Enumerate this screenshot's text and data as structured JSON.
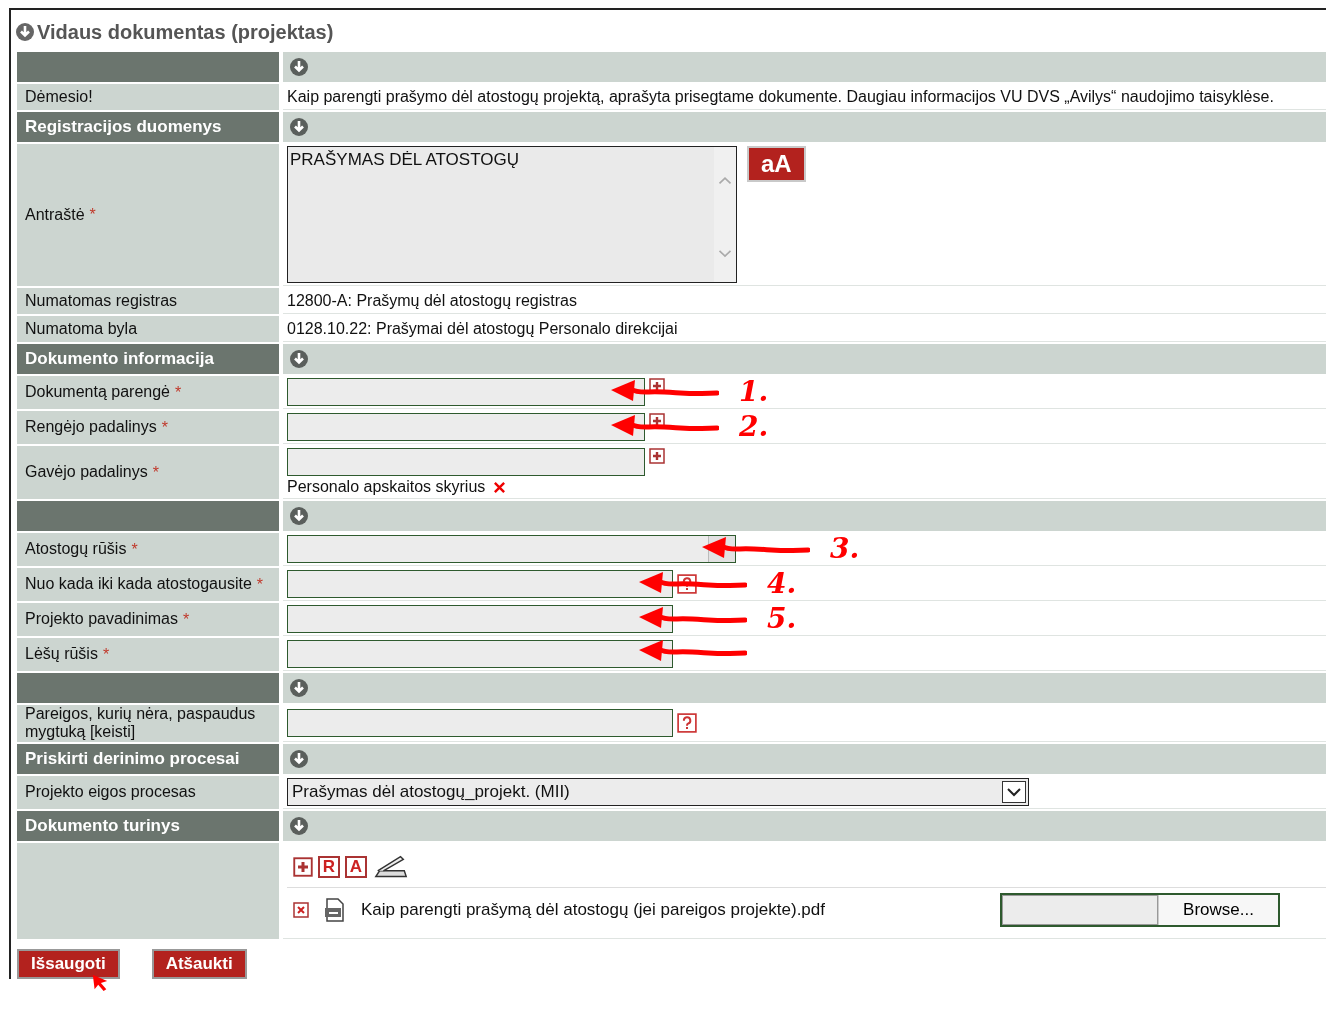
{
  "title": "Vidaus dokumentas (projektas)",
  "sections": [
    {
      "rows": [
        {
          "kind": "text",
          "label": "Dėmesio!",
          "value": "Kaip parengti prašymo dėl atostogų projektą, aprašyta prisegtame dokumente. Daugiau informacijos VU DVS „Avilys“ naudojimo taisyklėse."
        }
      ]
    },
    {
      "heading": "Registracijos duomenys",
      "rows": [
        {
          "kind": "textarea",
          "label": "Antraštė",
          "mark": "*",
          "value": "PRAŠYMAS DĖL ATOSTOGŲ",
          "case_button": "aA"
        },
        {
          "kind": "text",
          "label": "Numatomas registras",
          "value": "12800-A: Prašymų dėl atostogų registras"
        },
        {
          "kind": "text",
          "label": "Numatoma byla",
          "value": "0128.10.22: Prašymai dėl atostogų Personalo direkcijai"
        }
      ]
    },
    {
      "heading": "Dokumento informacija",
      "rows": [
        {
          "kind": "input",
          "label": "Dokumentą parengė",
          "mark": "*",
          "add_button": true,
          "arrow": true,
          "note": "1."
        },
        {
          "kind": "input",
          "label": "Rengėjo padalinys",
          "mark": "*",
          "add_button": true,
          "arrow": true,
          "note": "2."
        },
        {
          "kind": "input",
          "label": "Gavėjo padalinys",
          "mark": "*",
          "add_button": true,
          "items": [
            "Personalo apskaitos skyrius"
          ]
        }
      ]
    },
    {
      "rows": [
        {
          "kind": "combo",
          "label": "Atostogų rūšis",
          "mark": "*",
          "arrow": true,
          "note": "3."
        },
        {
          "kind": "wide",
          "label": "Nuo kada iki kada atostogausite",
          "mark": "*",
          "help_button": true,
          "arrow": true,
          "note": "4."
        },
        {
          "kind": "wide",
          "label": "Projekto pavadinimas",
          "mark": "*",
          "arrow": true,
          "note": "5."
        },
        {
          "kind": "wide",
          "label": "Lėšų rūšis",
          "mark": "*",
          "arrow": true
        }
      ]
    },
    {
      "rows": [
        {
          "kind": "wide",
          "label": "Pareigos, kurių nėra, paspaudus mygtuką [keisti]",
          "help_button": true
        }
      ]
    },
    {
      "heading": "Priskirti derinimo procesai",
      "rows": [
        {
          "kind": "select",
          "label": "Projekto eigos procesas",
          "value": "Prašymas dėl atostogų_projekt. (MII)"
        }
      ]
    },
    {
      "heading": "Dokumento turinys",
      "rows": [
        {
          "kind": "files",
          "toolbar_letters": [
            "R",
            "A"
          ],
          "files": [
            {
              "name": "Kaip parengti prašymą dėl atostogų (jei pareigos projekte).pdf",
              "browse": "Browse..."
            }
          ]
        }
      ]
    }
  ],
  "buttons": [
    {
      "label": "Išsaugoti",
      "pointer": true
    },
    {
      "label": "Atšaukti"
    }
  ]
}
